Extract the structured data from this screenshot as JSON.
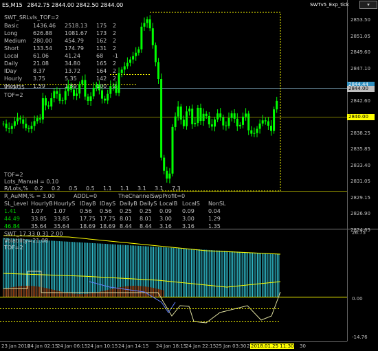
{
  "window": {
    "title": "ES,M15",
    "ohlc": "2842.75 2844.00 2842.50 2844.00",
    "indicator_name": "SWTv5_Exp_tick",
    "btn_minimize": "▾",
    "btn_restore": "▭",
    "btn_close": "✕"
  },
  "stats": {
    "title": "SWT_SRLvls_TOF=2",
    "rows": [
      {
        "name": "Basic",
        "a": "1436.46",
        "b": "2518.13",
        "c": "175",
        "d": "2"
      },
      {
        "name": "Long",
        "a": "626.88",
        "b": "1081.67",
        "c": "173",
        "d": "2"
      },
      {
        "name": "Medium",
        "a": "280.00",
        "b": "454.79",
        "c": "162",
        "d": "2"
      },
      {
        "name": "Short",
        "a": "133.54",
        "b": "174.79",
        "c": "131",
        "d": "2"
      },
      {
        "name": "Local",
        "a": "61.06",
        "b": "41.24",
        "c": "68",
        "d": "-1"
      },
      {
        "name": "Daily",
        "a": "21.08",
        "b": "34.80",
        "c": "165",
        "d": "2"
      },
      {
        "name": "IDay",
        "a": "8.37",
        "b": "13.72",
        "c": "164",
        "d": "2"
      },
      {
        "name": "Hourly",
        "a": "3.75",
        "b": "5.35",
        "c": "142",
        "d": "2"
      },
      {
        "name": "IHour",
        "a": "1.59",
        "b": "1.59",
        "c": "100",
        "d": "2"
      }
    ],
    "v_label": "V=3.35",
    "tof_label": "TOF=2"
  },
  "lots": {
    "tof": "TOF=2",
    "manual": "Lots_Manual = 0.10",
    "row_label": "R/Lots,%",
    "row_values": [
      "0.2",
      "0.2",
      "0.5",
      "0.5",
      "1.1",
      "1.1",
      "3.1",
      "3.1",
      "7.3"
    ],
    "aum": "R_AuMM,% = 3.00",
    "addl": "ADDL=0",
    "profit": "TheChannelSwpProfit=0"
  },
  "sl_table": {
    "headers": [
      "SL_Level",
      "HourlyB",
      "HourlyS",
      "IDayB",
      "IDayS",
      "DailyB",
      "DailyS",
      "LocalB",
      "LocalS",
      "NonSL"
    ],
    "rows": [
      {
        "color": "#00c000",
        "cells": [
          "1.41",
          "1.07",
          "1.07",
          "0.56",
          "0.56",
          "0.25",
          "0.25",
          "0.09",
          "0.09",
          "0.04"
        ]
      },
      {
        "color": "#00c000",
        "cells": [
          "44.49",
          "33.85",
          "33.85",
          "17.75",
          "17.75",
          "8.01",
          "8.01",
          "3.00",
          "3.00",
          "1.29"
        ]
      },
      {
        "color": "#00e000",
        "cells": [
          "46.84",
          "35.64",
          "35.64",
          "18.69",
          "18.69",
          "8.44",
          "8.44",
          "3.16",
          "3.16",
          "1.35"
        ]
      }
    ]
  },
  "price_axis": {
    "labels": [
      "2853.50",
      "2851.05",
      "2849.60",
      "2847.10",
      "2844.75",
      "2842.60",
      "2840.00",
      "2838.25",
      "2835.85",
      "2833.40",
      "2831.05",
      "2829.15",
      "2826.90",
      "2824.65"
    ],
    "current_price": "2844.00",
    "level_price": "2844.44",
    "green_price": "2840.00"
  },
  "sub_window": {
    "title": "SWT_17.33 0.31 2.00",
    "volatility": "Volatility=21.08",
    "tof": "TOF=2",
    "axis_top": "26.75",
    "axis_zero": "0.00",
    "axis_bottom": "-14.76"
  },
  "time_axis": {
    "labels": [
      "23 Jan 2018",
      "24 Jan 02:15",
      "24 Jan 06:15",
      "24 Jan 10:15",
      "24 Jan 14:15",
      "24 Jan 18:15",
      "24 Jan 22:15",
      "25 Jan 03:30",
      "25 Jan"
    ],
    "highlight": "2018.01.25 11:30",
    "highlight_tail": "30"
  },
  "colors": {
    "background": "#000000",
    "candle": "#00ff00",
    "grid": "#808000",
    "level_yellow": "#ffff00",
    "bar_cyan": "#30c0d0",
    "bar_brown": "#a04010",
    "price_box_current": "#c0c0c0",
    "price_box_green": "#ffff00"
  }
}
